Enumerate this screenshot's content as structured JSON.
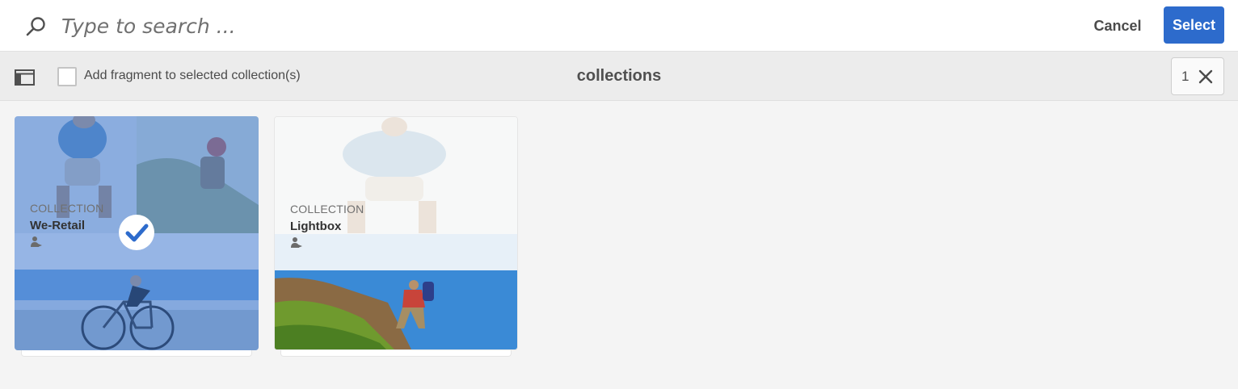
{
  "search": {
    "placeholder": "Type to search ..."
  },
  "topbar": {
    "cancel_label": "Cancel",
    "select_label": "Select"
  },
  "actionbar": {
    "checkbox_label": "Add fragment to selected collection(s)",
    "title": "collections",
    "selected_count": "1"
  },
  "cards": [
    {
      "type": "COLLECTION",
      "name": "We-Retail",
      "selected": true,
      "icon": "person-share-icon"
    },
    {
      "type": "COLLECTION",
      "name": "Lightbox",
      "selected": false,
      "icon": "person-share-icon"
    }
  ],
  "colors": {
    "accent": "#2d6bcc",
    "background": "#f4f4f4"
  }
}
